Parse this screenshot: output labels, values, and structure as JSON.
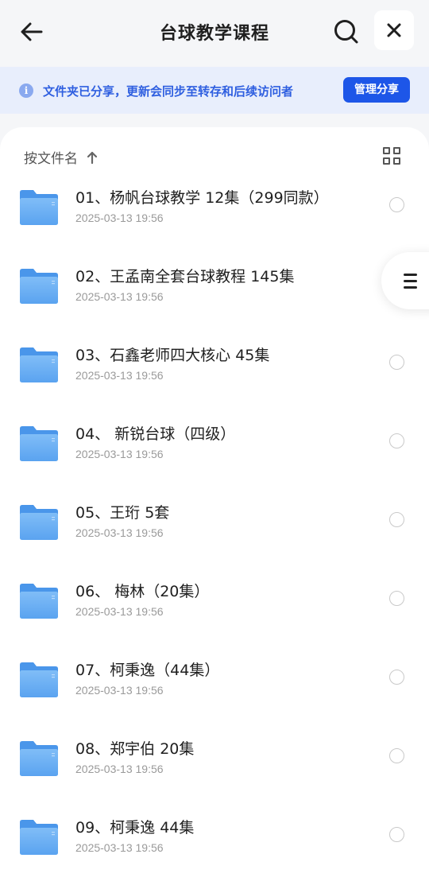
{
  "header": {
    "title": "台球教学课程",
    "back_icon": "back-arrow-icon",
    "search_icon": "search-icon",
    "close_icon": "close-icon"
  },
  "notice": {
    "icon": "info-icon",
    "icon_glyph": "i",
    "text": "文件夹已分享，更新会同步至转存和后续访问者",
    "button_label": "管理分享"
  },
  "toolbar": {
    "sort_label": "按文件名",
    "sort_icon": "sort-up-arrow-icon",
    "view_icon": "grid-view-icon"
  },
  "files": [
    {
      "name": "01、杨帆台球教学 12集（299同款）",
      "date": "2025-03-13 19:56"
    },
    {
      "name": "02、王孟南全套台球教程 145集",
      "date": "2025-03-13 19:56"
    },
    {
      "name": "03、石鑫老师四大核心 45集",
      "date": "2025-03-13 19:56"
    },
    {
      "name": "04、 新锐台球（四级）",
      "date": "2025-03-13 19:56"
    },
    {
      "name": "05、王珩 5套",
      "date": "2025-03-13 19:56"
    },
    {
      "name": "06、 梅林（20集）",
      "date": "2025-03-13 19:56"
    },
    {
      "name": "07、柯秉逸（44集）",
      "date": "2025-03-13 19:56"
    },
    {
      "name": "08、郑宇伯 20集",
      "date": "2025-03-13 19:56"
    },
    {
      "name": "09、柯秉逸 44集",
      "date": "2025-03-13 19:56"
    }
  ],
  "colors": {
    "accent": "#1d56e8",
    "notice_bg": "#e8eefc",
    "folder": "#6aaef3"
  },
  "float_menu_icon": "list-menu-icon"
}
